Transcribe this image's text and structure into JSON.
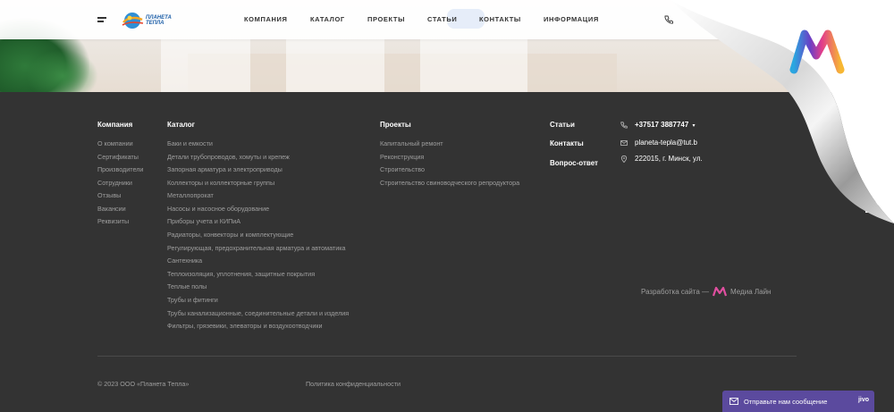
{
  "header": {
    "nav": [
      {
        "label": "КОМПАНИЯ"
      },
      {
        "label": "КАТАЛОГ"
      },
      {
        "label": "ПРОЕКТЫ"
      },
      {
        "label": "СТАТЬИ"
      },
      {
        "label": "КОНТАКТЫ"
      },
      {
        "label": "ИНФОРМАЦИЯ"
      }
    ],
    "logo_text_line1": "ПЛАНЕТА",
    "logo_text_line2": "ТЕПЛА"
  },
  "footer": {
    "company": {
      "heading": "Компания",
      "links": [
        "О компании",
        "Сертификаты",
        "Производители",
        "Сотрудники",
        "Отзывы",
        "Вакансии",
        "Реквизиты"
      ]
    },
    "catalog": {
      "heading": "Каталог",
      "links": [
        "Баки и емкости",
        "Детали трубопроводов, хомуты и крепеж",
        "Запорная арматура и электроприводы",
        "Коллекторы и коллекторные группы",
        "Металлопрокат",
        "Насосы и насосное оборудование",
        "Приборы учета и КИПиА",
        "Радиаторы, конвекторы и комплектующие",
        "Регулирующая, предохранительная арматура и автоматика",
        "Сантехника",
        "Теплоизоляция, уплотнения, защитные покрытия",
        "Теплые полы",
        "Трубы и фитинги",
        "Трубы канализационные, соединительные детали и изделия",
        "Фильтры, грязевики, элеваторы и воздухоотводчики"
      ]
    },
    "projects": {
      "heading": "Проекты",
      "links": [
        "Капитальный ремонт",
        "Реконструкция",
        "Строительство",
        "Строительство свиноводческого репродуктора"
      ]
    },
    "extra_headings": [
      "Статьи",
      "Контакты",
      "Вопрос-ответ"
    ],
    "contacts": {
      "phone": "+37517 3887747",
      "email": "planeta-tepla@tut.b",
      "address": "222015, г. Минск, ул."
    },
    "copyright": "© 2023 ООО «Планета Тепла»",
    "privacy": "Политика конфиденциальности",
    "developer_prefix": "Разработка сайта —",
    "developer_name": "Медиа Лайн"
  },
  "chat": {
    "label": "Отправьте нам сообщение",
    "brand": "jivo"
  },
  "colors": {
    "footer_bg": "#333333",
    "chat_bg": "#5b4a9e",
    "logo_blue": "#1d5fa8"
  }
}
